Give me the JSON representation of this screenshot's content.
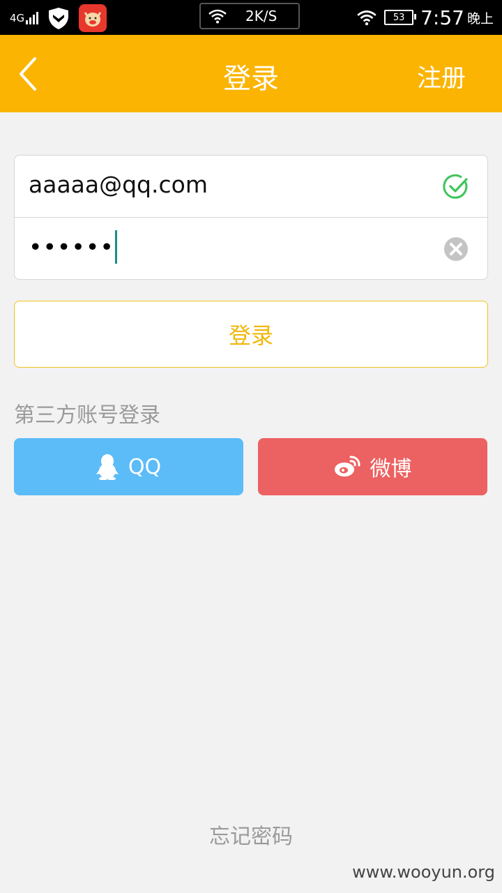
{
  "status_bar": {
    "network": "4G",
    "speed": "2K/S",
    "battery": "53",
    "time": "7:57",
    "ampm": "晚上"
  },
  "header": {
    "title": "登录",
    "register_label": "注册",
    "bg_color": "#fbb402"
  },
  "form": {
    "email_value": "aaaaa@qq.com",
    "password_value": "••••••",
    "email_valid_icon": "check-circle-icon",
    "clear_icon": "clear-circle-icon"
  },
  "login_button": {
    "label": "登录"
  },
  "third_party": {
    "label": "第三方账号登录",
    "qq_label": "QQ",
    "weibo_label": "微博",
    "qq_color": "#5cbcf8",
    "weibo_color": "#ec6161"
  },
  "forgot_password": "忘记密码",
  "watermark": "www.wooyun.org"
}
